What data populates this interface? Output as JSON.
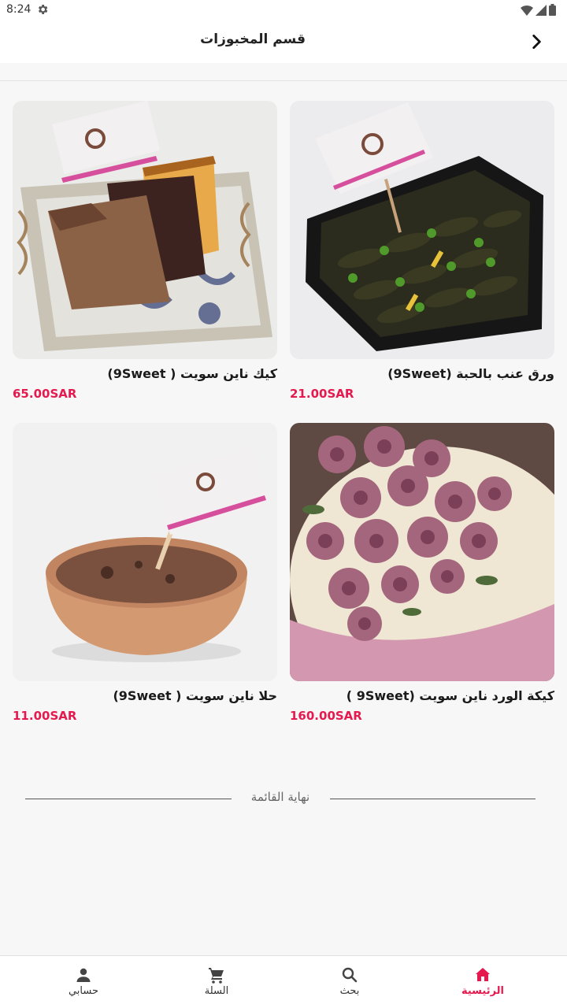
{
  "status": {
    "time": "8:24"
  },
  "header": {
    "title": "قسم المخبوزات"
  },
  "products": [
    {
      "name": "ورق عنب بالحبة (9Sweet)",
      "price": "21.00SAR"
    },
    {
      "name": "كيك ناين سويت ( 9Sweet)",
      "price": "65.00SAR"
    },
    {
      "name": "كيكة الورد  ناين سويت (9Sweet )",
      "price": "160.00SAR"
    },
    {
      "name": "حلا ناين سويت ( 9Sweet)",
      "price": "11.00SAR"
    }
  ],
  "end_of_list": "نهاية القائمة",
  "nav": {
    "home": "الرئيسية",
    "search": "بحث",
    "cart": "السلة",
    "account": "حسابي"
  },
  "colors": {
    "accent": "#e5194e"
  }
}
